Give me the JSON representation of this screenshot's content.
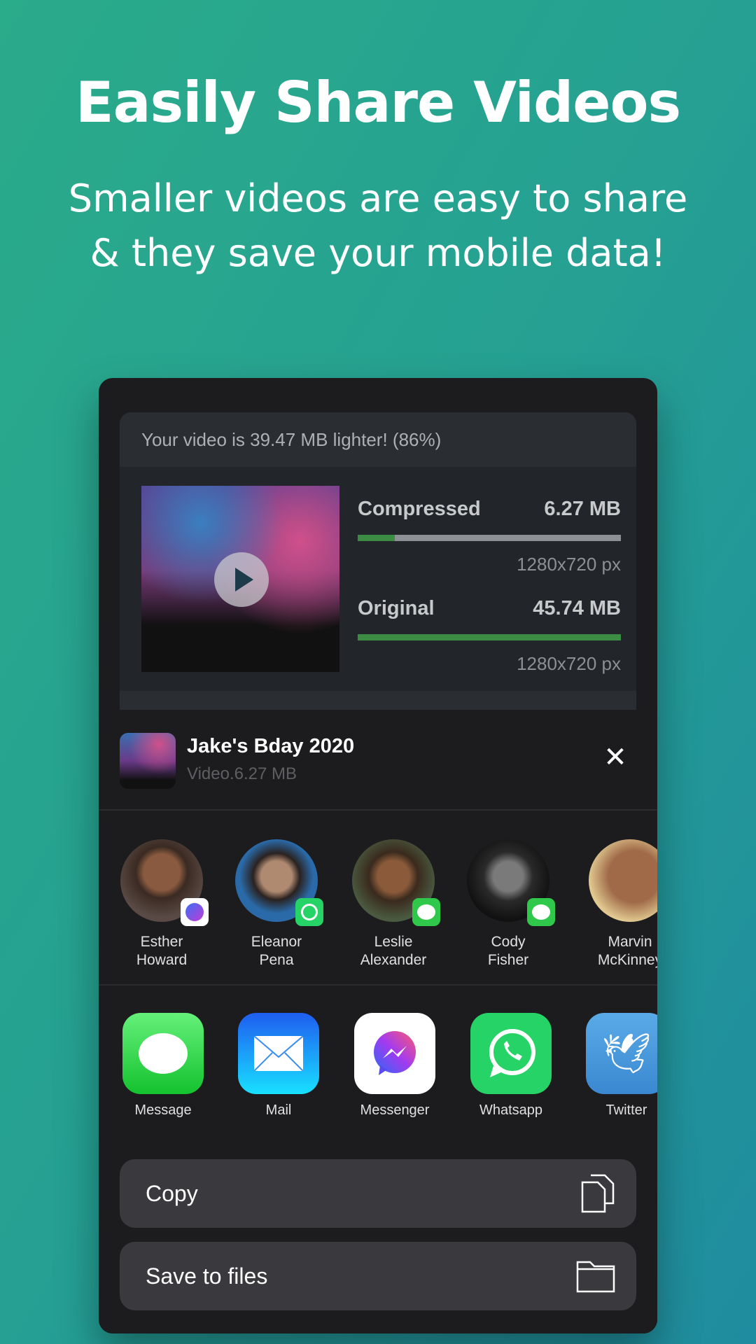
{
  "hero": {
    "title": "Easily Share Videos",
    "subtitle_line1": "Smaller videos are easy to share",
    "subtitle_line2": "& they save your mobile data!"
  },
  "result": {
    "summary": "Your video is 39.47 MB lighter! (86%)",
    "compressed": {
      "label": "Compressed",
      "size": "6.27 MB",
      "resolution": "1280x720 px",
      "bar_fraction": 0.14
    },
    "original": {
      "label": "Original",
      "size": "45.74 MB",
      "resolution": "1280x720 px",
      "bar_fraction": 1.0
    },
    "colors": {
      "bar_fill": "#3d8c44",
      "bar_track": "#8d9196"
    }
  },
  "share": {
    "title": "Jake's Bday 2020",
    "subtitle": "Video.6.27 MB",
    "close_icon": "close-icon",
    "contacts": [
      {
        "line1": "Esther",
        "line2": "Howard",
        "via": "messenger"
      },
      {
        "line1": "Eleanor",
        "line2": "Pena",
        "via": "whatsapp"
      },
      {
        "line1": "Leslie",
        "line2": "Alexander",
        "via": "message"
      },
      {
        "line1": "Cody",
        "line2": "Fisher",
        "via": "message"
      },
      {
        "line1": "Marvin",
        "line2": "McKinney",
        "via": ""
      }
    ],
    "apps": [
      {
        "label": "Message",
        "color": "#2fc84a"
      },
      {
        "label": "Mail",
        "color": "#1b8cf5"
      },
      {
        "label": "Messenger",
        "color": "#ffffff"
      },
      {
        "label": "Whatsapp",
        "color": "#25d366"
      },
      {
        "label": "Twitter",
        "color": "#4a9be0"
      }
    ],
    "actions": [
      {
        "label": "Copy",
        "icon": "copy-icon"
      },
      {
        "label": "Save to files",
        "icon": "folder-icon"
      }
    ]
  }
}
